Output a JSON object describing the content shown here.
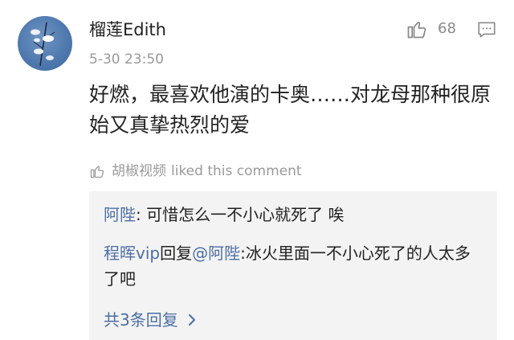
{
  "comment": {
    "username": "榴莲Edith",
    "timestamp": "5-30 23:50",
    "like_count": "68",
    "text": "好燃，最喜欢他演的卡奥……对龙母那种很原始又真挚热烈的爱"
  },
  "liked_by": {
    "name": "胡椒视频",
    "suffix": "liked this comment"
  },
  "replies": [
    {
      "user": "阿陛",
      "separator": ": ",
      "text": "可惜怎么一不小心就死了 唉"
    },
    {
      "user": "程晖vip",
      "middle": "回复",
      "mention": "@阿陛",
      "separator": ":",
      "text": "冰火里面一不小心死了的人太多了吧"
    }
  ],
  "more_replies": "共3条回复",
  "icons": {
    "like": "thumbs-up-icon",
    "reply": "comment-icon",
    "liked": "thumbs-up-icon",
    "more": "chevron-right-icon"
  },
  "colors": {
    "link": "#4c6ea4",
    "secondary_text": "#9a9a9a",
    "reply_background": "#f3f3f3"
  }
}
